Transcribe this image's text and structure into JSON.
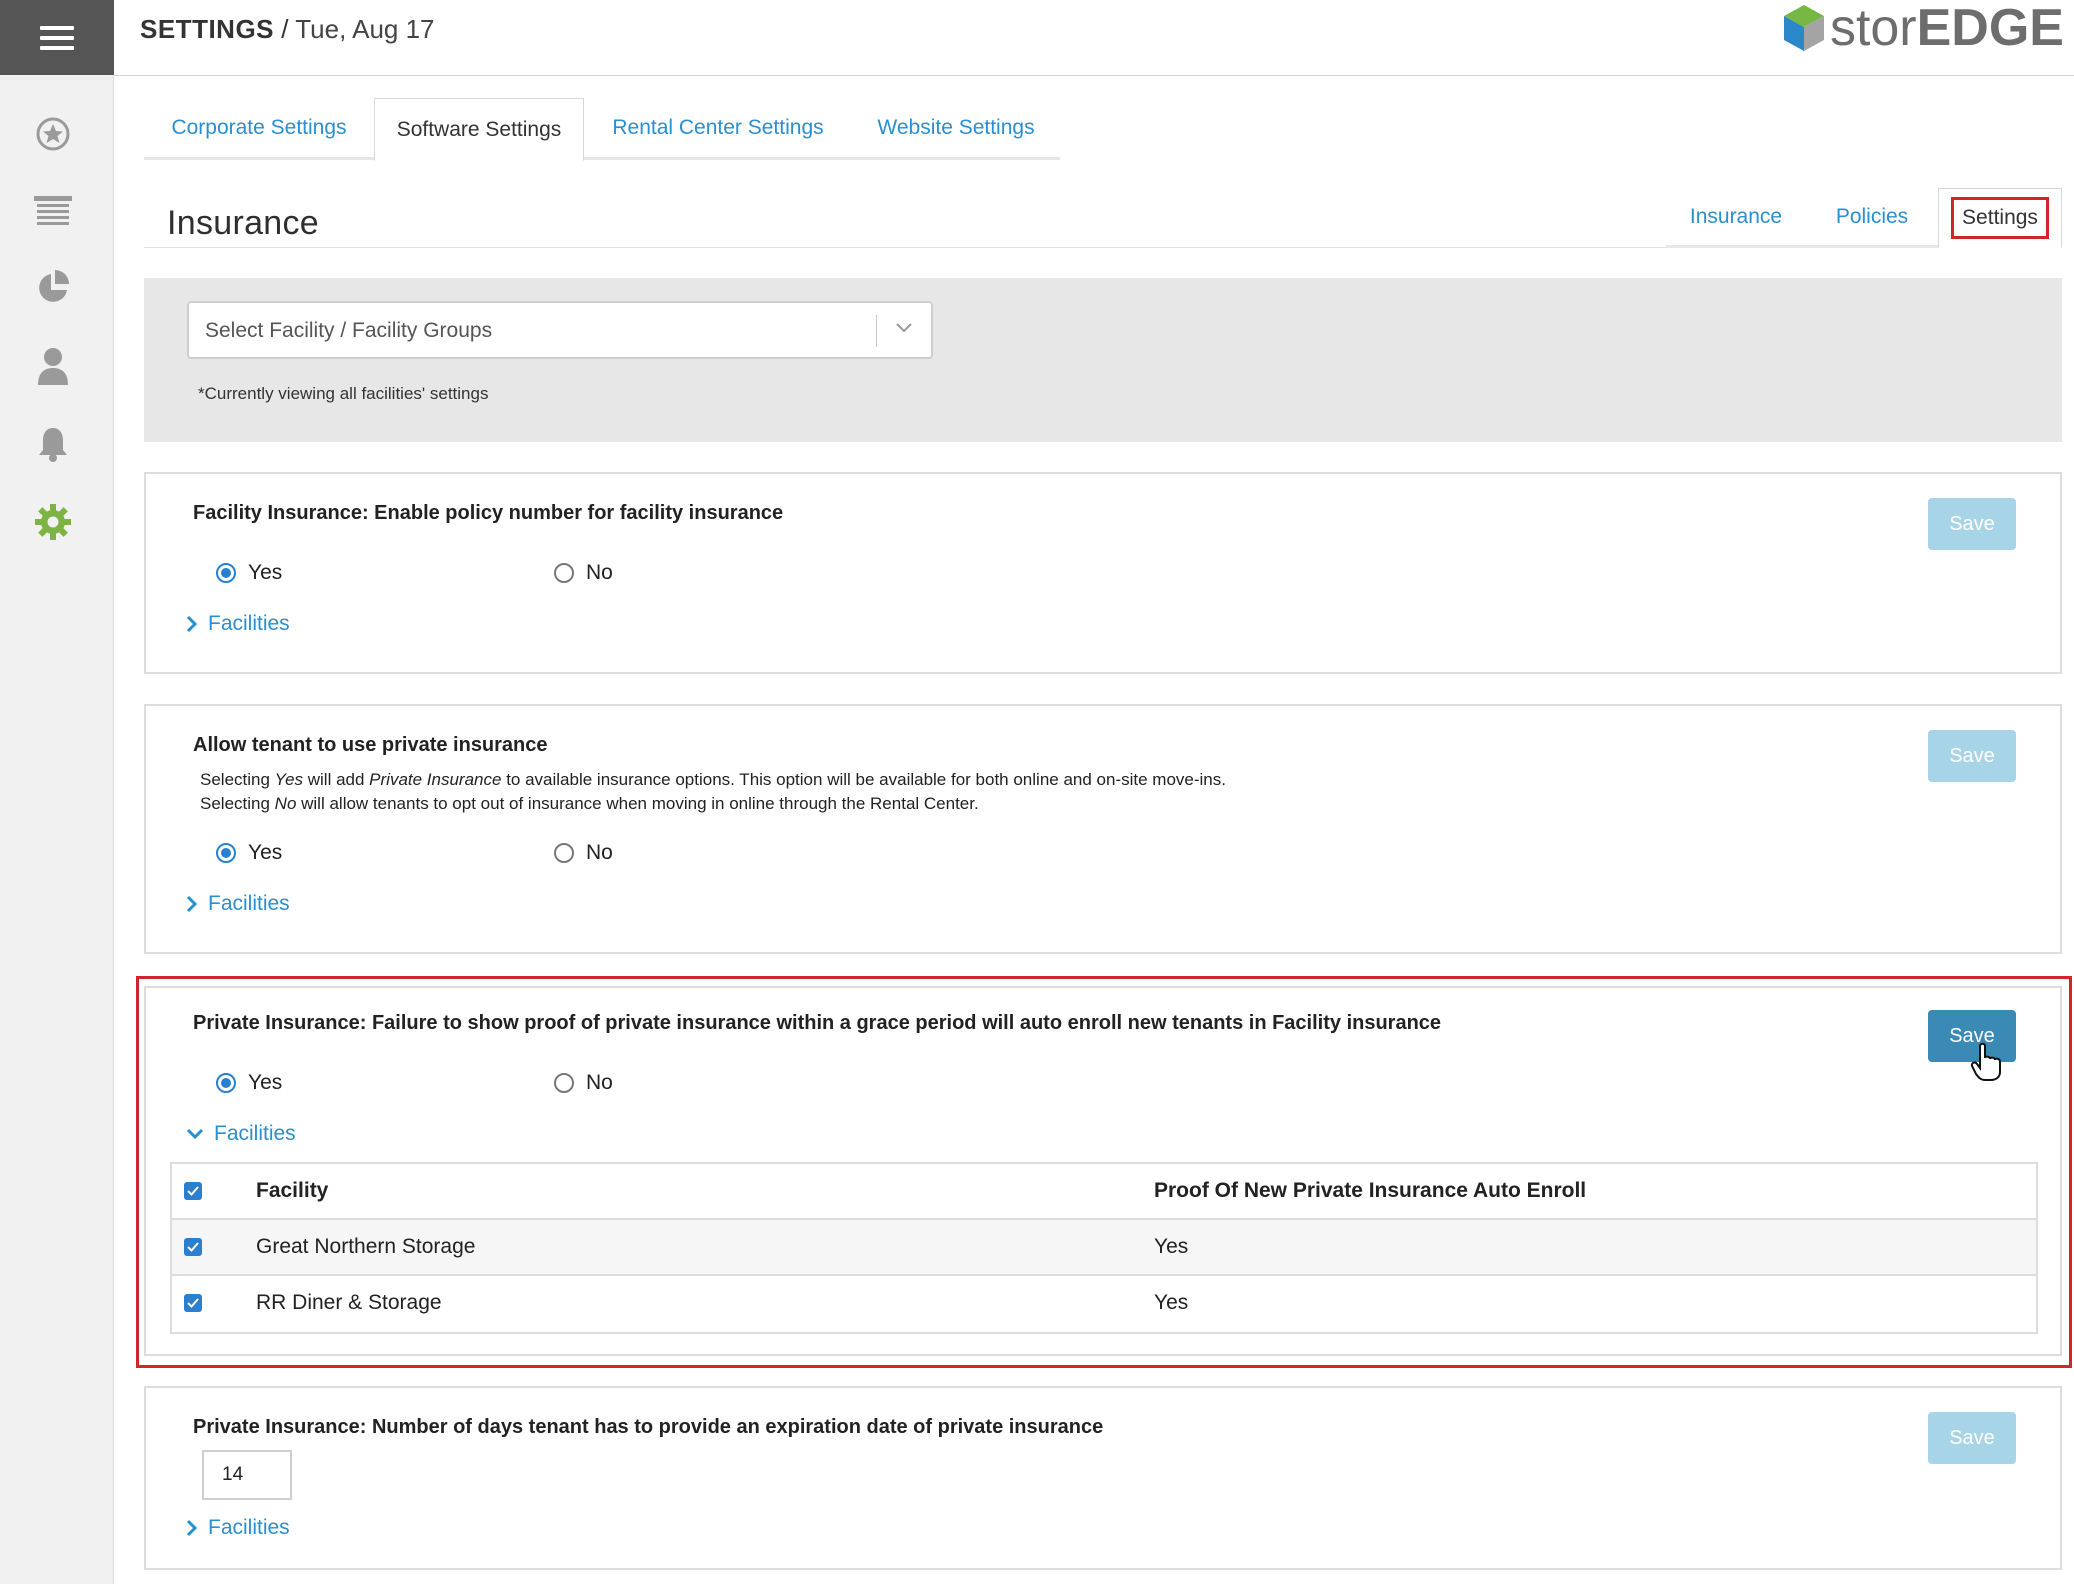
{
  "header": {
    "section": "SETTINGS",
    "separator": "/",
    "date": "Tue, Aug 17",
    "logo_thin": "stor",
    "logo_bold": "EDGE"
  },
  "rail": {
    "icons": [
      "menu-icon",
      "star-icon",
      "list-icon",
      "pie-chart-icon",
      "user-icon",
      "bell-icon",
      "gear-icon"
    ],
    "active_color": "#7cb342"
  },
  "main_tabs": [
    {
      "label": "Corporate Settings",
      "active": false
    },
    {
      "label": "Software Settings",
      "active": true
    },
    {
      "label": "Rental Center Settings",
      "active": false
    },
    {
      "label": "Website Settings",
      "active": false
    }
  ],
  "section": {
    "title": "Insurance",
    "tabs": [
      {
        "label": "Insurance",
        "active": false
      },
      {
        "label": "Policies",
        "active": false
      },
      {
        "label": "Settings",
        "active": true
      }
    ]
  },
  "filter": {
    "placeholder": "Select Facility / Facility Groups",
    "note": "*Currently viewing all facilities' settings"
  },
  "settings": [
    {
      "title": "Facility Insurance: Enable policy number for facility insurance",
      "yes_label": "Yes",
      "no_label": "No",
      "selected": "Yes",
      "facilities_label": "Facilities",
      "save_label": "Save",
      "save_enabled": false
    },
    {
      "title": "Allow tenant to use private insurance",
      "desc_line1_a": "Selecting ",
      "desc_line1_yes": "Yes",
      "desc_line1_b": " will add ",
      "desc_line1_pi": "Private Insurance",
      "desc_line1_c": " to available insurance options. This option will be available for both online and on-site move-ins.",
      "desc_line2_a": "Selecting ",
      "desc_line2_no": "No",
      "desc_line2_b": " will allow tenants to opt out of insurance when moving in online through the Rental Center.",
      "yes_label": "Yes",
      "no_label": "No",
      "selected": "Yes",
      "facilities_label": "Facilities",
      "save_label": "Save",
      "save_enabled": false
    },
    {
      "title": "Private Insurance: Failure to show proof of private insurance within a grace period will auto enroll new tenants in Facility insurance",
      "yes_label": "Yes",
      "no_label": "No",
      "selected": "Yes",
      "facilities_label": "Facilities",
      "save_label": "Save",
      "save_enabled": true,
      "table": {
        "headers": [
          "Facility",
          "Proof Of New Private Insurance Auto Enroll"
        ],
        "rows": [
          {
            "facility": "Great Northern Storage",
            "value": "Yes",
            "checked": true
          },
          {
            "facility": "RR Diner & Storage",
            "value": "Yes",
            "checked": true
          }
        ]
      }
    },
    {
      "title": "Private Insurance: Number of days tenant has to provide an expiration date of private insurance",
      "input_value": "14",
      "facilities_label": "Facilities",
      "save_label": "Save",
      "save_enabled": false
    }
  ],
  "colors": {
    "link": "#2a8fd0",
    "save_disabled": "#a8d4e8",
    "save_enabled": "#3a8ab5",
    "highlight": "#d0262b",
    "menu_bg": "#555555"
  }
}
